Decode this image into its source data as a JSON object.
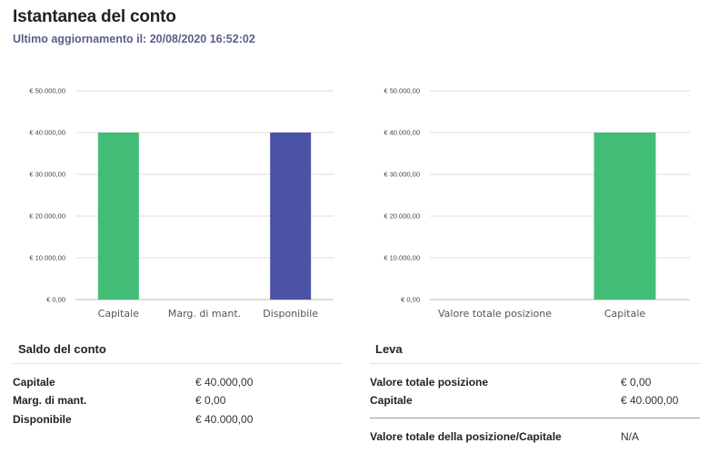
{
  "header": {
    "title": "Istantanea del conto",
    "subtitle": "Ultimo aggiornamento il: 20/08/2020 16:52:02"
  },
  "colors": {
    "green": "#42bd78",
    "indigo": "#4b53a6",
    "grid": "#dedede"
  },
  "chart_data": [
    {
      "type": "bar",
      "categories": [
        "Capitale",
        "Marg. di mant.",
        "Disponibile"
      ],
      "values": [
        40000,
        0,
        40000
      ],
      "bar_colors": [
        "#42bd78",
        "#42bd78",
        "#4b53a6"
      ],
      "yticks": [
        "€ 0,00",
        "€ 10.000,00",
        "€ 20.000,00",
        "€ 30.000,00",
        "€ 40.000,00",
        "€ 50.000,00"
      ],
      "ylim": [
        0,
        50000
      ],
      "grid": true
    },
    {
      "type": "bar",
      "categories": [
        "Valore totale posizione",
        "Capitale"
      ],
      "values": [
        0,
        40000
      ],
      "bar_colors": [
        "#42bd78",
        "#42bd78"
      ],
      "yticks": [
        "€ 0,00",
        "€ 10.000,00",
        "€ 20.000,00",
        "€ 30.000,00",
        "€ 40.000,00",
        "€ 50.000,00"
      ],
      "ylim": [
        0,
        50000
      ],
      "grid": true
    }
  ],
  "saldo": {
    "title": "Saldo del conto",
    "rows": [
      {
        "label": "Capitale",
        "value": "€ 40.000,00"
      },
      {
        "label": "Marg. di mant.",
        "value": "€ 0,00"
      },
      {
        "label": "Disponibile",
        "value": "€ 40.000,00"
      }
    ]
  },
  "leva": {
    "title": "Leva",
    "rows": [
      {
        "label": "Valore totale posizione",
        "value": "€ 0,00"
      },
      {
        "label": "Capitale",
        "value": "€ 40.000,00"
      }
    ],
    "ratio": {
      "label": "Valore totale della posizione/Capitale",
      "value": "N/A"
    }
  }
}
